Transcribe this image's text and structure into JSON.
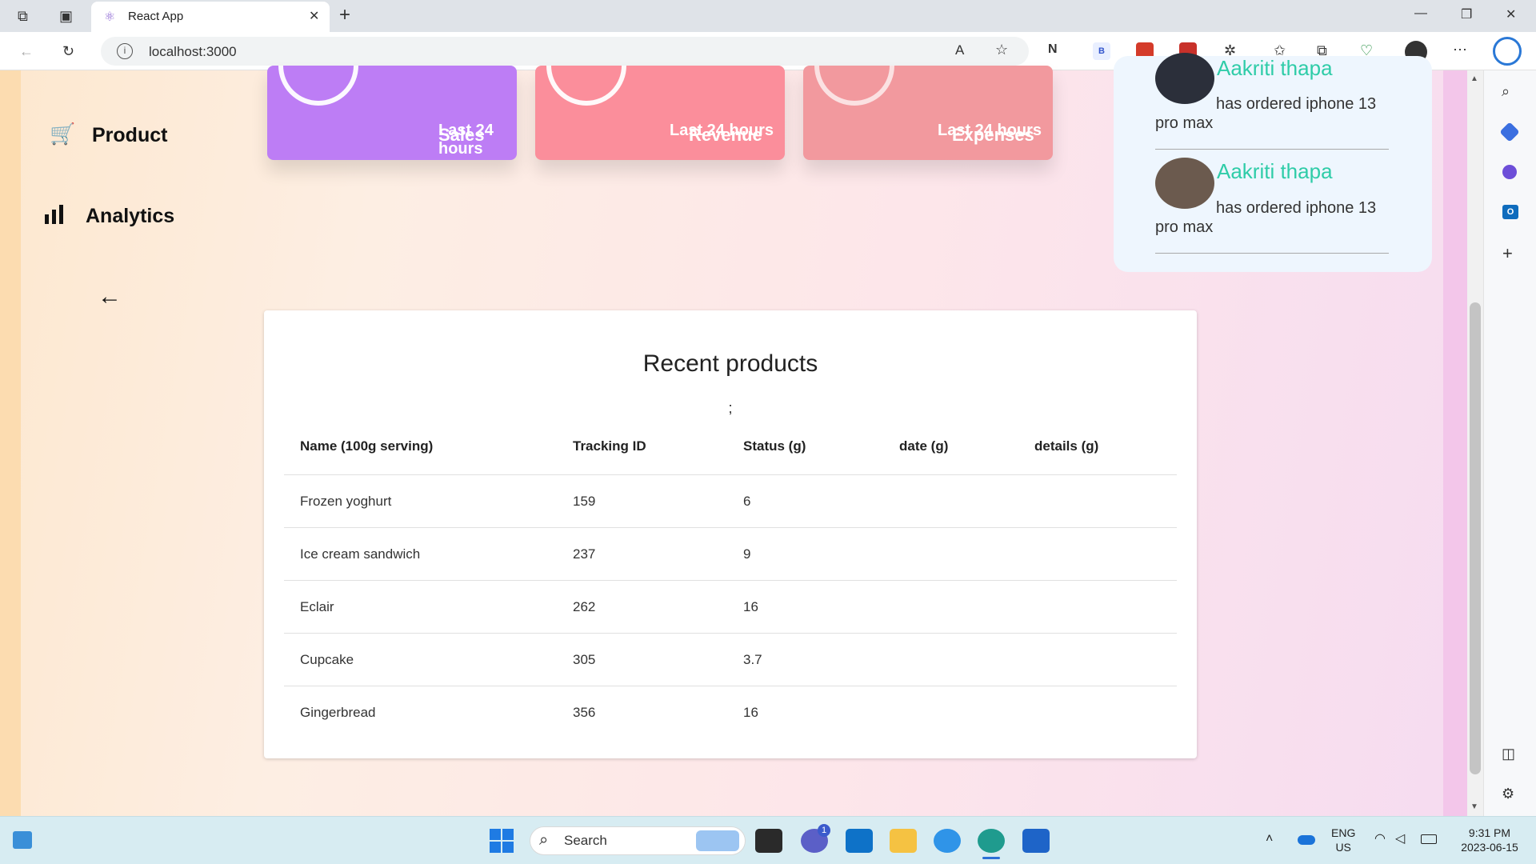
{
  "browser": {
    "tab_title": "React App",
    "new_tab": "+",
    "url": "localhost:3000",
    "window_controls": {
      "minimize": "—",
      "restore": "❐",
      "close": "✕"
    }
  },
  "sidebar": {
    "items": [
      {
        "label": "Product",
        "icon": "cart-icon"
      },
      {
        "label": "Analytics",
        "icon": "bar-chart-icon"
      }
    ],
    "back_arrow": "←"
  },
  "cards": [
    {
      "title": "Sales",
      "subtitle": "Last 24 hours",
      "color": "#bd7df5"
    },
    {
      "title": "Revenue",
      "subtitle": "Last 24 hours",
      "color": "#fb8e9b"
    },
    {
      "title": "Expenses",
      "subtitle": "Last 24 hours",
      "color": "#f2999e"
    }
  ],
  "updates": [
    {
      "name": "Aakriti thapa",
      "text_line1": "has ordered iphone 13",
      "text_line2": "pro max"
    },
    {
      "name": "Aakriti thapa",
      "text_line1": "has ordered iphone 13",
      "text_line2": "pro max"
    }
  ],
  "table": {
    "title": "Recent products",
    "note": ";",
    "columns": [
      "Name (100g serving)",
      "Tracking ID",
      "Status (g)",
      "date (g)",
      "details (g)"
    ],
    "rows": [
      [
        "Frozen yoghurt",
        "159",
        "6"
      ],
      [
        "Ice cream sandwich",
        "237",
        "9"
      ],
      [
        "Eclair",
        "262",
        "16"
      ],
      [
        "Cupcake",
        "305",
        "3.7"
      ],
      [
        "Gingerbread",
        "356",
        "16"
      ]
    ]
  },
  "taskbar": {
    "search_label": "Search",
    "chat_badge": "1",
    "lang_line1": "ENG",
    "lang_line2": "US",
    "time": "9:31 PM",
    "date": "2023-06-15"
  }
}
